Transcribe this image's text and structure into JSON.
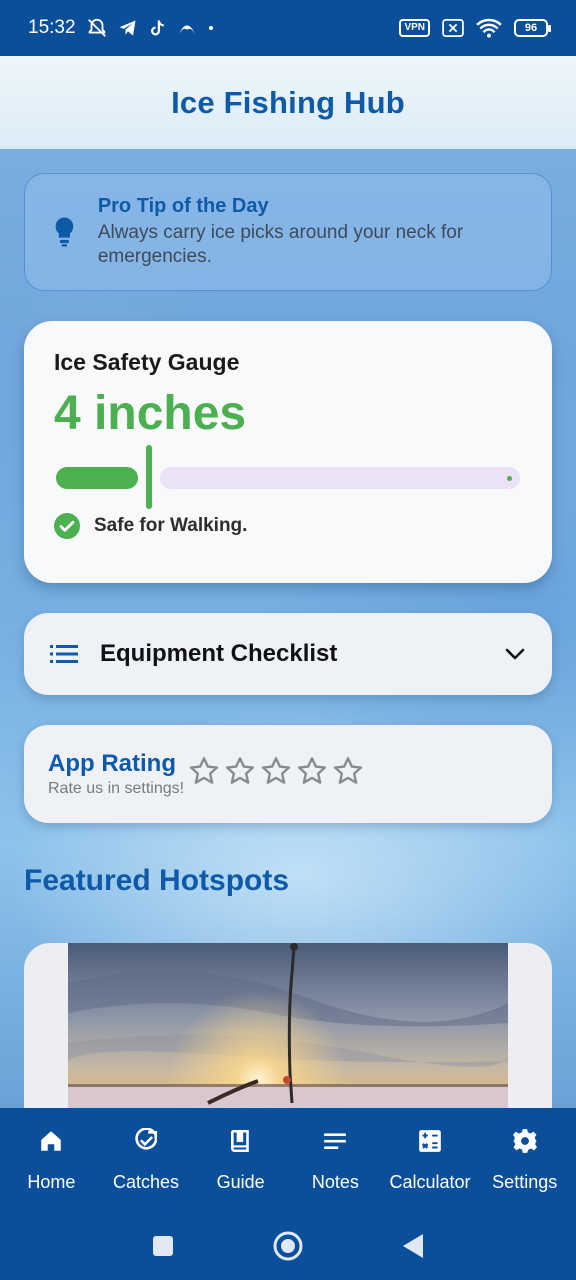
{
  "status_bar": {
    "time": "15:32",
    "vpn_label": "VPN",
    "battery": "96"
  },
  "header": {
    "title": "Ice Fishing Hub"
  },
  "tip": {
    "title": "Pro Tip of the Day",
    "text": "Always carry ice picks around your neck for emergencies."
  },
  "gauge": {
    "title": "Ice Safety Gauge",
    "value": "4 inches",
    "status": "Safe for Walking.",
    "level_fraction": 0.2,
    "color": "#4caf50"
  },
  "checklist": {
    "label": "Equipment Checklist"
  },
  "rating": {
    "title": "App Rating",
    "subtitle": "Rate us in settings!",
    "stars_filled": 0,
    "stars_total": 5
  },
  "featured": {
    "title": "Featured Hotspots"
  },
  "nav": {
    "items": [
      {
        "label": "Home",
        "icon": "home-icon"
      },
      {
        "label": "Catches",
        "icon": "catches-icon"
      },
      {
        "label": "Guide",
        "icon": "book-icon"
      },
      {
        "label": "Notes",
        "icon": "notes-icon"
      },
      {
        "label": "Calculator",
        "icon": "calculator-icon"
      },
      {
        "label": "Settings",
        "icon": "gear-icon"
      }
    ]
  },
  "colors": {
    "primary": "#0b4f9a",
    "accent_text": "#0f5aa8",
    "safe_green": "#4caf50"
  }
}
